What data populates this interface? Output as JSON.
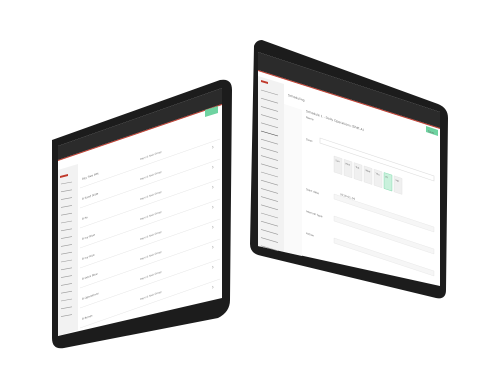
{
  "colors": {
    "background": "#ffffff",
    "bezel": "#1f1f1f",
    "topbar": "#2b2b2b",
    "accent_red": "#c0392b",
    "accent_green": "#6fd3a1",
    "sidebar_bg": "#f2f2f2"
  },
  "left_tablet": {
    "rows": [
      {
        "label": "Bay Tree 40k",
        "detail": "Days & Task Group"
      },
      {
        "label": "B Sand Slide",
        "detail": "Days & Task Group"
      },
      {
        "label": "B Po",
        "detail": "Days & Task Group"
      },
      {
        "label": "B Ivy Blue",
        "detail": "Days & Task Group"
      },
      {
        "label": "B Ivy Rick",
        "detail": "Days & Task Group"
      },
      {
        "label": "B Dock Blue",
        "detail": "Days & Task Group"
      },
      {
        "label": "B Operations",
        "detail": "Days & Task Group"
      },
      {
        "label": "B Bones",
        "detail": "Days & Task Group"
      }
    ]
  },
  "right_tablet": {
    "header_title": "Scheduling",
    "section_title": "Schedule 1 - Daily Operations (Shift A)",
    "days": [
      "Sun",
      "Mon",
      "Tue",
      "Wed",
      "Thu",
      "Fri",
      "Sat"
    ],
    "selected_day": "Fri",
    "fields": [
      {
        "label": "Name",
        "value": ""
      },
      {
        "label": "Days",
        "value": ""
      },
      {
        "label": "Dates",
        "value": "2019-01-04"
      },
      {
        "label": "Start date",
        "value": ""
      },
      {
        "label": "Interval type",
        "value": ""
      },
      {
        "label": "Action",
        "value": ""
      }
    ],
    "save_label": "Save"
  }
}
